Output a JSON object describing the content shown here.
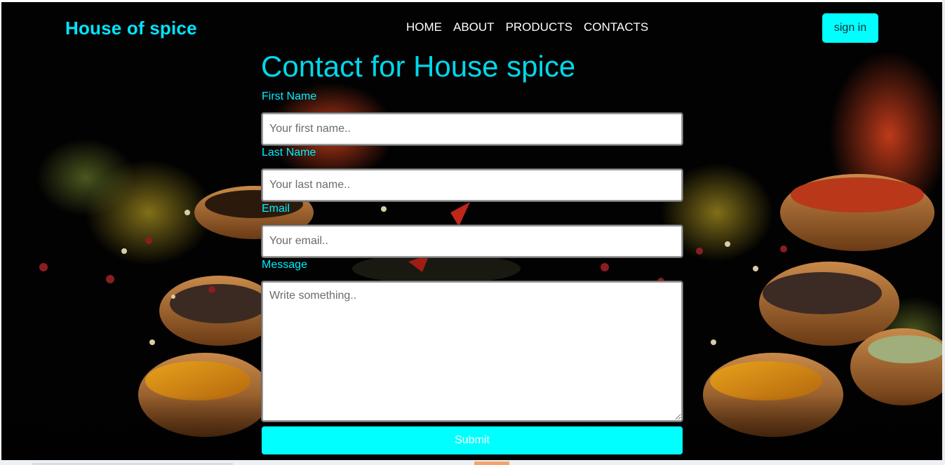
{
  "brand": {
    "title": "House of spice"
  },
  "nav": {
    "items": [
      "HOME",
      "ABOUT",
      "PRODUCTS",
      "CONTACTS"
    ]
  },
  "header": {
    "signin_label": "sign in"
  },
  "form": {
    "title": "Contact for House spice",
    "first_name": {
      "label": "First Name",
      "placeholder": "Your first name.."
    },
    "last_name": {
      "label": "Last Name",
      "placeholder": "Your last name.."
    },
    "email": {
      "label": "Email",
      "placeholder": "Your email.."
    },
    "message": {
      "label": "Message",
      "placeholder": "Write something.."
    },
    "submit_label": "Submit"
  },
  "colors": {
    "accent": "#00ffff",
    "brand_text": "#00e5ff",
    "background": "#020202",
    "nav_text": "#ffffff"
  }
}
